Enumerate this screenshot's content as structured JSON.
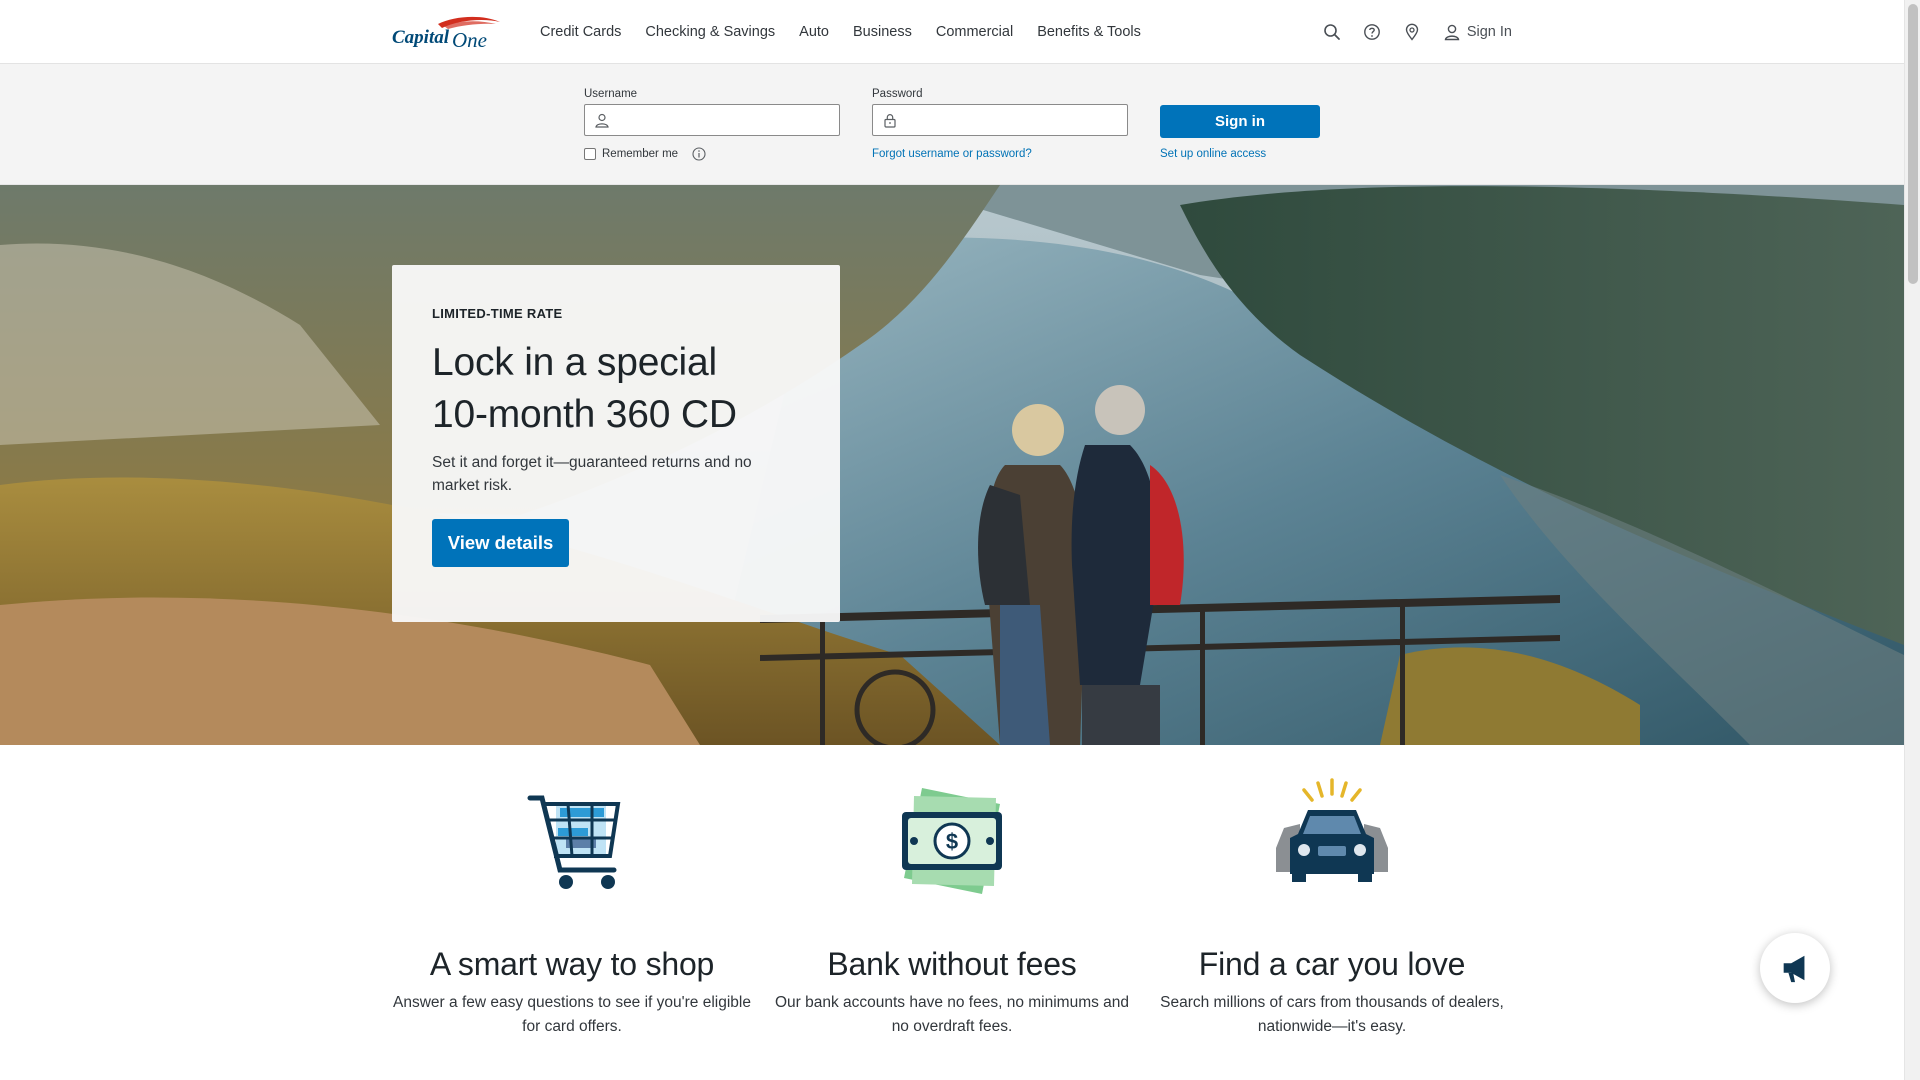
{
  "brand": {
    "name": "Capital One",
    "primary": "#0073ba",
    "logo_red": "#d22e1e",
    "logo_navy": "#004977"
  },
  "nav": {
    "items": [
      "Credit Cards",
      "Checking & Savings",
      "Auto",
      "Business",
      "Commercial",
      "Benefits & Tools"
    ]
  },
  "utilities": {
    "signin_label": "Sign In"
  },
  "login": {
    "username_label": "Username",
    "username_value": "",
    "password_label": "Password",
    "password_value": "",
    "remember_label": "Remember me",
    "forgot_link": "Forgot username or password?",
    "signin_button": "Sign in",
    "setup_link": "Set up online access"
  },
  "hero": {
    "eyebrow": "LIMITED-TIME RATE",
    "headline_line1": "Lock in a special",
    "headline_line2": "10-month 360 CD",
    "body": "Set it and forget it—guaranteed returns and no market risk.",
    "cta": "View details"
  },
  "features": [
    {
      "title": "A smart way to shop",
      "body": "Answer a few easy questions to see if you're eligible for card offers.",
      "icon": "shopping-cart-icon"
    },
    {
      "title": "Bank without fees",
      "body": "Our bank accounts have no fees, no minimums and no overdraft fees.",
      "icon": "cash-icon"
    },
    {
      "title": "Find a car you love",
      "body": "Search millions of cars from thousands of dealers, nationwide—it's easy.",
      "icon": "car-icon"
    }
  ],
  "feedback": {
    "icon": "megaphone-icon"
  }
}
